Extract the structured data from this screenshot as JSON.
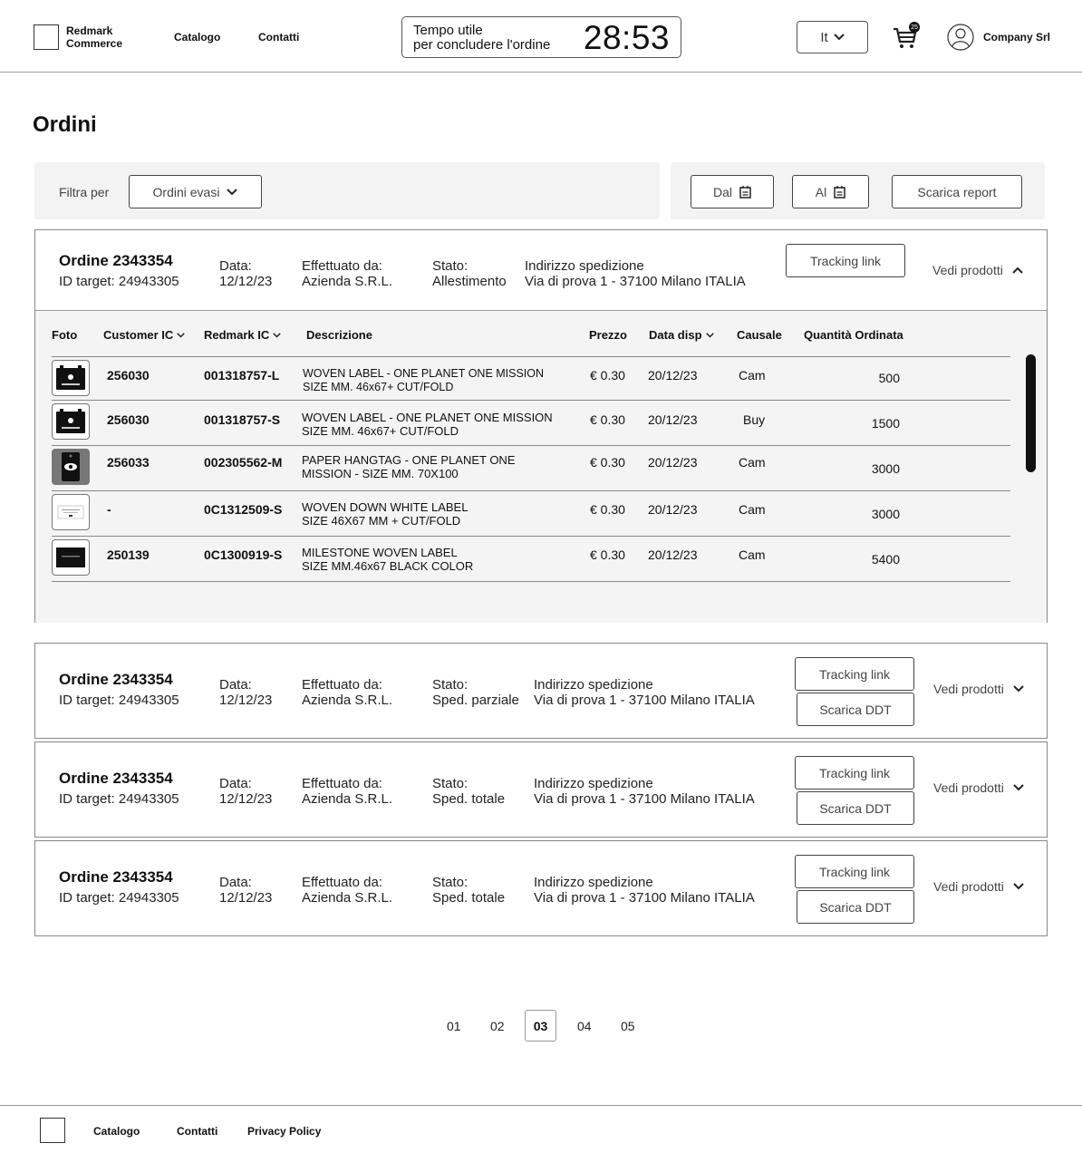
{
  "header": {
    "brand": [
      "Redmark",
      "Commerce"
    ],
    "nav": [
      "Catalogo",
      "Contatti"
    ],
    "timer_label": [
      "Tempo utile",
      "per concludere l'ordine"
    ],
    "timer_value": "28:53",
    "language": "It",
    "cart_count": "25",
    "company": "Company Srl"
  },
  "page_title": "Ordini",
  "filters": {
    "label": "Filtra per",
    "selected": "Ordini evasi",
    "from_label": "Dal",
    "to_label": "Al",
    "report_label": "Scarica report"
  },
  "labels": {
    "date": "Data:",
    "by": "Effettuato da:",
    "state": "Stato:",
    "address": "Indirizzo spedizione",
    "tracking": "Tracking link",
    "ddt": "Scarica DDT",
    "see_products": "Vedi prodotti"
  },
  "orders": [
    {
      "title": "Ordine 2343354",
      "target": "ID target: 24943305",
      "date": "12/12/23",
      "by": "Azienda S.R.L.",
      "state": "Allestimento",
      "address": "Via di prova 1 - 37100 Milano ITALIA",
      "expanded": true
    },
    {
      "title": "Ordine 2343354",
      "target": "ID target: 24943305",
      "date": "12/12/23",
      "by": "Azienda S.R.L.",
      "state": "Sped. parziale",
      "address": "Via di prova 1 - 37100 Milano ITALIA",
      "expanded": false
    },
    {
      "title": "Ordine 2343354",
      "target": "ID target: 24943305",
      "date": "12/12/23",
      "by": "Azienda S.R.L.",
      "state": "Sped. totale",
      "address": "Via di prova 1 - 37100 Milano ITALIA",
      "expanded": false
    },
    {
      "title": "Ordine 2343354",
      "target": "ID target: 24943305",
      "date": "12/12/23",
      "by": "Azienda S.R.L.",
      "state": "Sped. totale",
      "address": "Via di prova 1 - 37100 Milano ITALIA",
      "expanded": false
    }
  ],
  "product_table": {
    "headers": [
      "Foto",
      "Customer IC",
      "Redmark IC",
      "Descrizione",
      "Prezzo",
      "Data disp",
      "Causale",
      "Quantità Ordinata"
    ],
    "rows": [
      {
        "customer_ic": "256030",
        "redmark_ic": "001318757-L",
        "desc1": "WOVEN LABEL - ONE PLANET ONE MISSION",
        "desc2": "SIZE  MM. 46x67+ CUT/FOLD",
        "price": "€ 0.30",
        "date": "20/12/23",
        "causale": "Cam",
        "qty": "500"
      },
      {
        "customer_ic": "256030",
        "redmark_ic": "001318757-S",
        "desc1": "WOVEN LABEL - ONE PLANET ONE MISSION",
        "desc2": "SIZE  MM. 46x67+ CUT/FOLD",
        "price": "€ 0.30",
        "date": "20/12/23",
        "causale": "Buy",
        "qty": "1500"
      },
      {
        "customer_ic": "256033",
        "redmark_ic": "002305562-M",
        "desc1": "PAPER HANGTAG - ONE PLANET ONE",
        "desc2": "MISSION  -  SIZE  MM. 70X100",
        "price": "€ 0.30",
        "date": "20/12/23",
        "causale": "Cam",
        "qty": "3000"
      },
      {
        "customer_ic": "-",
        "redmark_ic": "0C1312509-S",
        "desc1": "WOVEN DOWN WHITE LABEL",
        "desc2": "SIZE 46X67 MM + CUT/FOLD",
        "price": "€ 0.30",
        "date": "20/12/23",
        "causale": "Cam",
        "qty": "3000"
      },
      {
        "customer_ic": "250139",
        "redmark_ic": "0C1300919-S",
        "desc1": "MILESTONE WOVEN LABEL",
        "desc2": "SIZE MM.46x67 BLACK COLOR",
        "price": "€ 0.30",
        "date": "20/12/23",
        "causale": "Cam",
        "qty": "5400"
      }
    ]
  },
  "pagination": [
    "01",
    "02",
    "03",
    "04",
    "05"
  ],
  "footer": [
    "Catalogo",
    "Contatti",
    "Privacy Policy"
  ]
}
